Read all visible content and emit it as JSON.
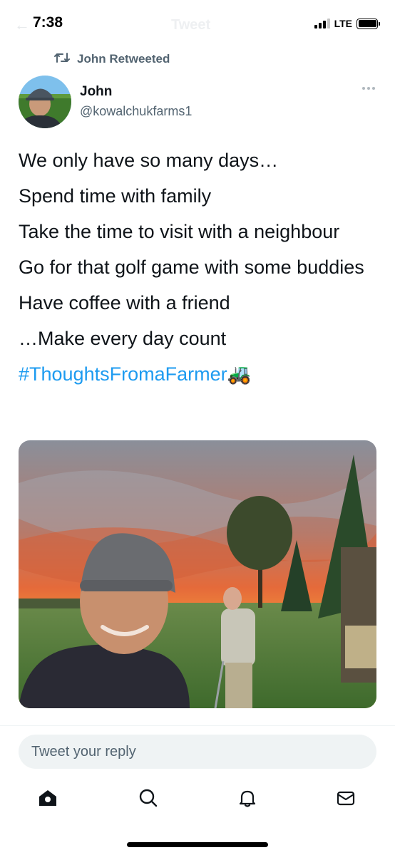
{
  "status_bar": {
    "time": "7:38",
    "network": "LTE",
    "signal_bars_active": 3,
    "signal_bars_total": 4
  },
  "ghost_header": {
    "title": "Tweet"
  },
  "retweet": {
    "label": "John Retweeted",
    "icon": "retweet-icon"
  },
  "author": {
    "name": "John",
    "handle": "@kowalchukfarms1",
    "more_icon": "more-dots-icon"
  },
  "tweet": {
    "lines": [
      "We only have so many days…",
      "Spend time with family",
      "Take the time to visit with a neighbour",
      "Go for that golf game with some buddies",
      "Have coffee with a friend",
      "…Make every day count"
    ],
    "hashtag": "#ThoughtsFromaFarmer",
    "emoji": "🚜"
  },
  "media": {
    "type": "photo"
  },
  "reply": {
    "placeholder": "Tweet your reply"
  },
  "tabbar": {
    "items": [
      "home-icon",
      "search-icon",
      "notifications-icon",
      "messages-icon"
    ]
  },
  "colors": {
    "accent": "#1d9bf0",
    "secondary_text": "#536471",
    "primary_text": "#0f1419"
  }
}
